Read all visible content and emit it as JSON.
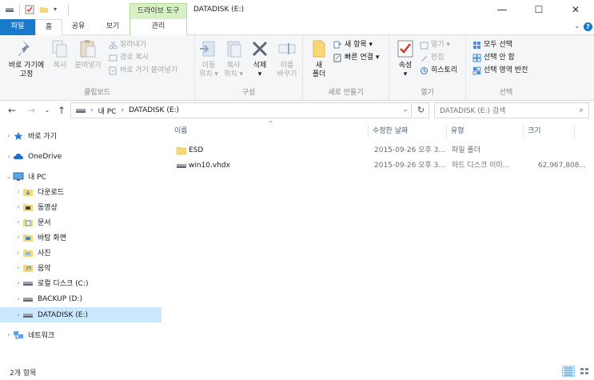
{
  "window": {
    "title": "DATADISK (E:)",
    "context_tab_group": "드라이브 도구",
    "minimize": "—",
    "maximize": "☐",
    "close": "✕"
  },
  "tabs": {
    "file": "파일",
    "home": "홈",
    "share": "공유",
    "view": "보기",
    "manage": "관리"
  },
  "ribbon": {
    "clipboard": {
      "label": "클립보드",
      "pin": "바로 가기에\n고정",
      "copy": "복사",
      "paste": "붙여넣기",
      "cut": "잘라내기",
      "copy_path": "경로 복사",
      "paste_shortcut": "바로 가기 붙여넣기"
    },
    "organize": {
      "label": "구성",
      "move_to": "이동\n위치 ▾",
      "copy_to": "복사\n위치 ▾",
      "delete": "삭제\n▾",
      "rename": "이름\n바꾸기"
    },
    "new": {
      "label": "새로 만들기",
      "new_folder": "새\n폴더",
      "new_item": "새 항목 ▾",
      "easy_access": "빠른 연결 ▾"
    },
    "open": {
      "label": "열기",
      "properties": "속성\n▾",
      "open": "열기 ▾",
      "edit": "편집",
      "history": "히스토리"
    },
    "select": {
      "label": "선택",
      "select_all": "모두 선택",
      "select_none": "선택 안 함",
      "invert": "선택 영역 반전"
    }
  },
  "address": {
    "crumbs": [
      "내 PC",
      "DATADISK (E:)"
    ],
    "search_placeholder": "DATADISK (E:) 검색"
  },
  "nav_pane": [
    {
      "label": "바로 가기",
      "icon": "star-icon"
    },
    {
      "label": "OneDrive",
      "icon": "cloud-icon"
    },
    {
      "label": "내 PC",
      "icon": "computer-icon"
    },
    {
      "label": "다운로드",
      "icon": "download-folder-icon"
    },
    {
      "label": "동영상",
      "icon": "video-folder-icon"
    },
    {
      "label": "문서",
      "icon": "document-folder-icon"
    },
    {
      "label": "바탕 화면",
      "icon": "desktop-folder-icon"
    },
    {
      "label": "사진",
      "icon": "pictures-folder-icon"
    },
    {
      "label": "음악",
      "icon": "music-folder-icon"
    },
    {
      "label": "로컬 디스크 (C:)",
      "icon": "drive-icon"
    },
    {
      "label": "BACKUP (D:)",
      "icon": "drive-icon"
    },
    {
      "label": "DATADISK (E:)",
      "icon": "drive-icon",
      "selected": true
    },
    {
      "label": "네트워크",
      "icon": "network-icon"
    }
  ],
  "columns": {
    "name": "이름",
    "modified": "수정한 날짜",
    "type": "유형",
    "size": "크기"
  },
  "files": [
    {
      "name": "ESD",
      "modified": "2015-09-26 오후 3...",
      "type": "파일 폴더",
      "size": "",
      "icon": "folder-icon"
    },
    {
      "name": "win10.vhdx",
      "modified": "2015-09-26 오후 3...",
      "type": "하드 디스크 이미...",
      "size": "62,967,808...",
      "icon": "disk-image-icon"
    }
  ],
  "status": {
    "item_count": "2개 항목"
  },
  "colors": {
    "accent": "#1979ca",
    "selection": "#cce8ff",
    "context_tab": "#d7f0c4",
    "folder": "#f8d775"
  }
}
